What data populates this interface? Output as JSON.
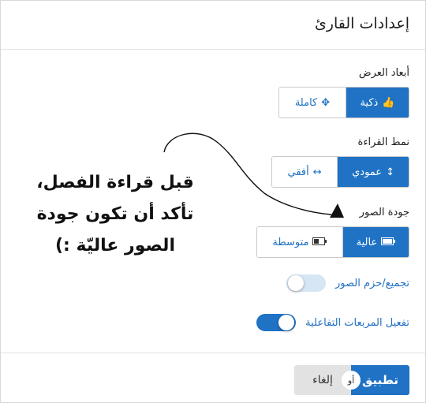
{
  "dialog": {
    "title": "إعدادات القارئ",
    "display": {
      "label": "أبعاد العرض",
      "options": [
        {
          "label": "ذكية",
          "icon": "thumbs-up-icon",
          "glyph": "👍",
          "active": true
        },
        {
          "label": "كاملة",
          "icon": "move-arrows-icon",
          "glyph": "✥",
          "active": false
        }
      ]
    },
    "reading": {
      "label": "نمط القراءة",
      "options": [
        {
          "label": "عمودي",
          "icon": "vertical-arrows-icon",
          "glyph": "↕",
          "active": true
        },
        {
          "label": "أفقي",
          "icon": "horizontal-arrows-icon",
          "glyph": "↔",
          "active": false
        }
      ]
    },
    "quality": {
      "label": "جودة الصور",
      "options": [
        {
          "label": "عالية",
          "icon": "battery-full-icon",
          "glyph": "▭",
          "active": true
        },
        {
          "label": "متوسطة",
          "icon": "battery-half-icon",
          "glyph": "▭",
          "active": false
        }
      ]
    },
    "toggles": [
      {
        "label": "تجميع/حزم الصور",
        "state": "off"
      },
      {
        "label": "تفعيل المربعات التفاعلية",
        "state": "on"
      }
    ],
    "footer": {
      "apply_label": "تطبيق",
      "or_label": "أو",
      "cancel_label": "إلغاء"
    }
  },
  "annotation": {
    "lines": [
      "قبل قراءة الفصل،",
      "تأكد أن تكون جودة",
      "الصور عاليّة :)"
    ]
  },
  "colors": {
    "accent": "#1f72c4",
    "accent_text": "#1f6fc2",
    "cancel_bg": "#e2e2e2",
    "toggle_off_track": "#d7e6f4"
  }
}
